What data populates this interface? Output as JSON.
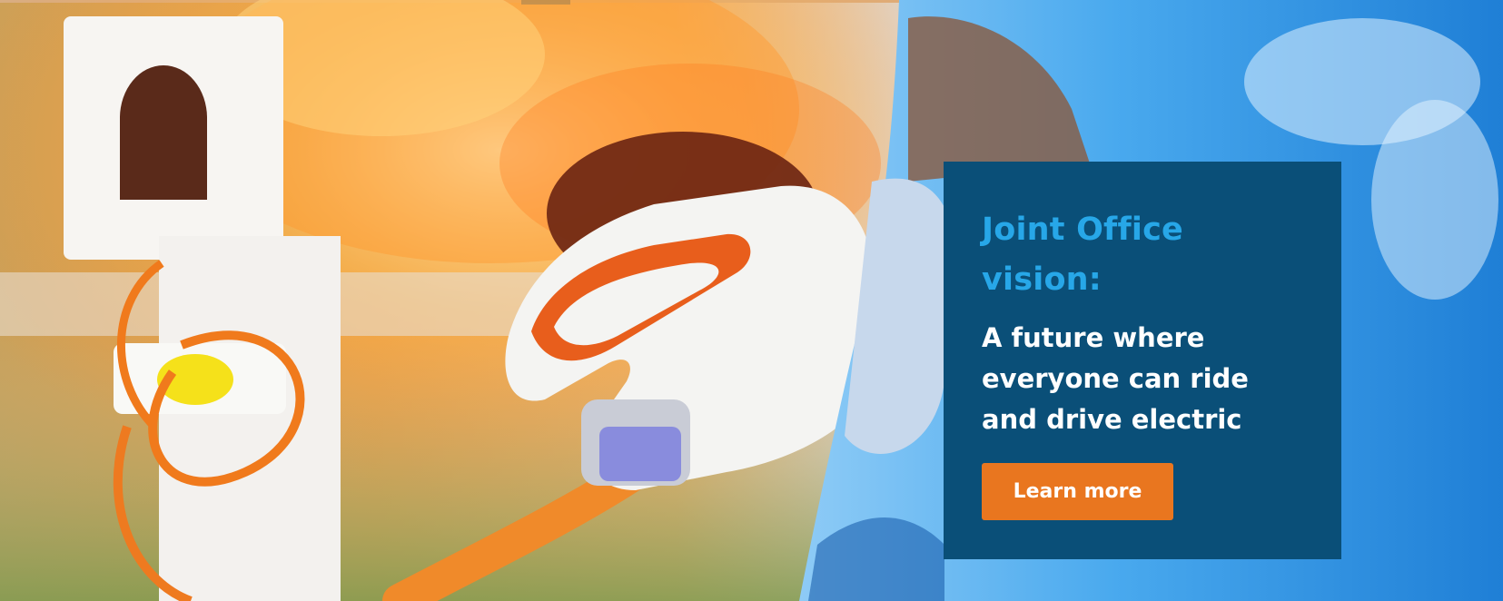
{
  "hero": {
    "image_description_icons": [
      "ev-charging-station-icon",
      "charging-plug-icon",
      "electric-car-icon"
    ],
    "colors": {
      "card_background": "#0a4f78",
      "eyebrow_text": "#27a7e8",
      "headline_text": "#ffffff",
      "button_background": "#e9761f",
      "button_text": "#ffffff"
    }
  },
  "promo": {
    "eyebrow": "Joint Office vision:",
    "headline": "A future where everyone can ride and drive electric",
    "button_label": "Learn more"
  }
}
